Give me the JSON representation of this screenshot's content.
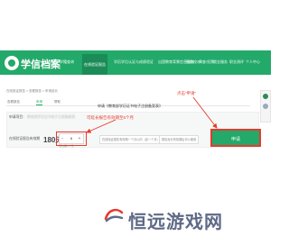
{
  "app": {
    "logo_text": "学信档案"
  },
  "nav": {
    "items": [
      "首页",
      "学籍查询",
      "在线验证报告",
      "学历学位认证与成绩验证",
      "出国教育背景信息服务",
      "图像校对",
      "调查/投票",
      "就业服务",
      "职业测评"
    ],
    "active_index": 3,
    "right_label": "个人中心"
  },
  "breadcrumb": "在线验证报告 > 查看报告 > 申请延长",
  "tabs": [
    "查看报告",
    "申请",
    "帮助"
  ],
  "form": {
    "title": "申请《教育部学历证书电子注册备案表》",
    "apply_label": "申请项目：",
    "apply_value": "教育部学历证书电子注册备案表",
    "duration_label": "在线验证报告有效期",
    "duration_value": "180天",
    "stepper_value": "6",
    "stepper_minus": "−",
    "stepper_plus": "+",
    "hint": "有效期6个月",
    "options": [
      "在线验证报告有效期一个月以内（含一个月）",
      "报告延长有效期后可以使用"
    ],
    "submit_label": "申请"
  },
  "annotations": {
    "click_apply": "点击“申请”",
    "validity_note": "可延长报告有效期至6个月"
  },
  "footer": {
    "site_name": "恒远游戏网"
  },
  "colors": {
    "brand": "#23a969",
    "annotation": "#e8392c",
    "footer_text": "#5e6a86"
  }
}
